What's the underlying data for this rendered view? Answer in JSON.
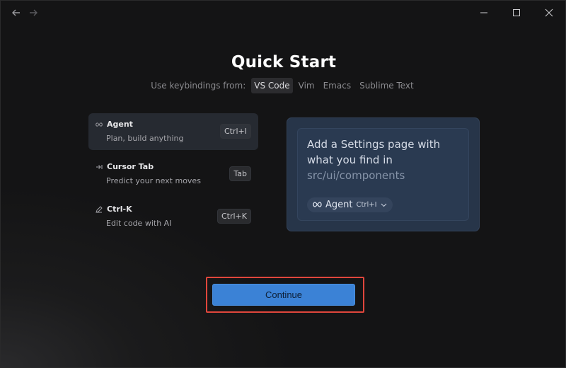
{
  "title": "Quick Start",
  "keybindings": {
    "label": "Use keybindings from:",
    "options": [
      "VS Code",
      "Vim",
      "Emacs",
      "Sublime Text"
    ],
    "selected": "VS Code"
  },
  "features": [
    {
      "name": "Agent",
      "description": "Plan, build anything",
      "shortcut": "Ctrl+I",
      "icon": "infinity-icon",
      "active": true
    },
    {
      "name": "Cursor Tab",
      "description": "Predict your next moves",
      "shortcut": "Tab",
      "icon": "tab-arrow-icon",
      "active": false
    },
    {
      "name": "Ctrl-K",
      "description": "Edit code with AI",
      "shortcut": "Ctrl+K",
      "icon": "pencil-icon",
      "active": false
    }
  ],
  "preview": {
    "prompt_text": "Add a Settings page with what you find in",
    "prompt_path": "src/ui/components",
    "mode_label": "Agent",
    "mode_shortcut": "Ctrl+I"
  },
  "continue_label": "Continue",
  "colors": {
    "accent": "#3b82d6",
    "highlight": "#e0463c",
    "preview_bg": "#273549"
  }
}
